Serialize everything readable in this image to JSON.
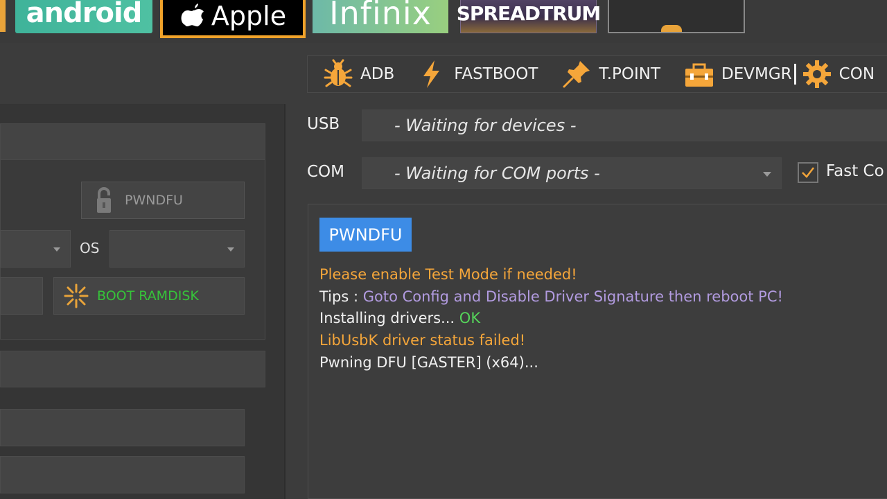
{
  "brands": {
    "android": "android",
    "apple": "Apple",
    "infinix": "Infinix",
    "spreadtrum": "SPREADTRUM"
  },
  "left": {
    "pwndfu_label": "PWNDFU",
    "os_label": "OS",
    "boot_ramdisk_label": "BOOT RAMDISK"
  },
  "toolbar": {
    "adb": "ADB",
    "fastboot": "FASTBOOT",
    "tpoint": "T.POINT",
    "devmgr": "DEVMGR",
    "config": "CON"
  },
  "usb": {
    "label": "USB",
    "value": "- Waiting for devices -"
  },
  "com": {
    "label": "COM",
    "value": "- Waiting for COM ports -"
  },
  "fast_connect": {
    "label": "Fast Co",
    "checked": true
  },
  "log": {
    "badge": "PWNDFU",
    "line1": "Please enable Test Mode if needed!",
    "tips_prefix": "Tips : ",
    "tips_text": "Goto Config and Disable Driver Signature then reboot PC!",
    "install_prefix": "Installing drivers... ",
    "install_status": "OK",
    "line4": "LibUsbK driver status failed!",
    "line5": "Pwning DFU [GASTER] (x64)..."
  },
  "colors": {
    "accent_orange": "#f5a63a",
    "badge_blue": "#3d8ce6",
    "tips_purple": "#b29be0",
    "ok_green": "#55d45a",
    "boot_green": "#36c33a"
  }
}
